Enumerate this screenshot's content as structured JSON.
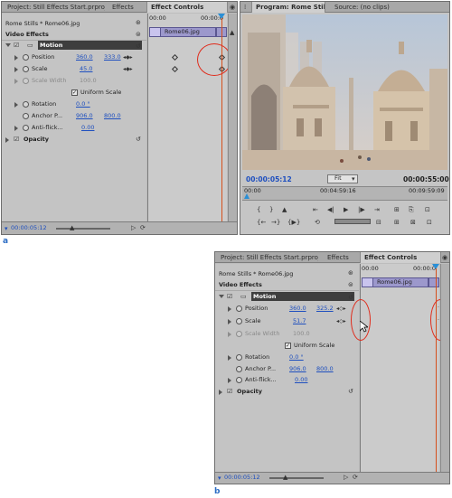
{
  "figure_a": {
    "label": "a",
    "effect_controls": {
      "tabs": [
        "Project: Still Effects Start.prproj",
        "Effects",
        "Effect Controls"
      ],
      "clip_path": "Rome Stills * Rome06.jpg",
      "timeline_start": "00:00",
      "timeline_end": "00:00:0",
      "clip_name": "Rome06.jpg",
      "section_title": "Video Effects",
      "motion_label": "Motion",
      "position": {
        "label": "Position",
        "x": "360.0",
        "y": "333.0"
      },
      "scale": {
        "label": "Scale",
        "value": "45.0"
      },
      "scale_width": {
        "label": "Scale Width",
        "value": "100.0"
      },
      "uniform_scale": "Uniform Scale",
      "rotation": {
        "label": "Rotation",
        "value": "0.0 °"
      },
      "anchor": {
        "label": "Anchor P...",
        "x": "906.0",
        "y": "800.0"
      },
      "antiflicker": {
        "label": "Anti-flick...",
        "value": "0.00"
      },
      "opacity_label": "Opacity",
      "bottom_timecode": "00:00:05:12"
    },
    "program_monitor": {
      "tabs": [
        "Program: Rome Stills",
        "Source: (no clips)"
      ],
      "timecode": "00:00:05:12",
      "zoom": "Fit",
      "duration": "00:00:55:00",
      "ruler_start": "00:00",
      "ruler_mid": "00:04:59:16",
      "ruler_end": "00:09:59:09"
    }
  },
  "figure_b": {
    "label": "b",
    "effect_controls": {
      "tabs": [
        "Project: Still Effects Start.prproj",
        "Effects",
        "Effect Controls"
      ],
      "clip_path": "Rome Stills * Rome06.jpg",
      "timeline_start": "00:00",
      "timeline_end": "00:00:0",
      "clip_name": "Rome06.jpg",
      "section_title": "Video Effects",
      "motion_label": "Motion",
      "position": {
        "label": "Position",
        "x": "360.0",
        "y": "325.2"
      },
      "scale": {
        "label": "Scale",
        "value": "51.7"
      },
      "scale_width": {
        "label": "Scale Width",
        "value": "100.0"
      },
      "uniform_scale": "Uniform Scale",
      "rotation": {
        "label": "Rotation",
        "value": "0.0 °"
      },
      "anchor": {
        "label": "Anchor P...",
        "x": "906.0",
        "y": "800.0"
      },
      "antiflicker": {
        "label": "Anti-flick...",
        "value": "0.00"
      },
      "opacity_label": "Opacity",
      "bottom_timecode": "00:00:05:12"
    }
  },
  "colors": {
    "accent_red": "#e02a1a",
    "value_blue": "#1e4fbf",
    "panel_gray": "#bdbdbd",
    "playhead_orange": "#d5501c"
  }
}
